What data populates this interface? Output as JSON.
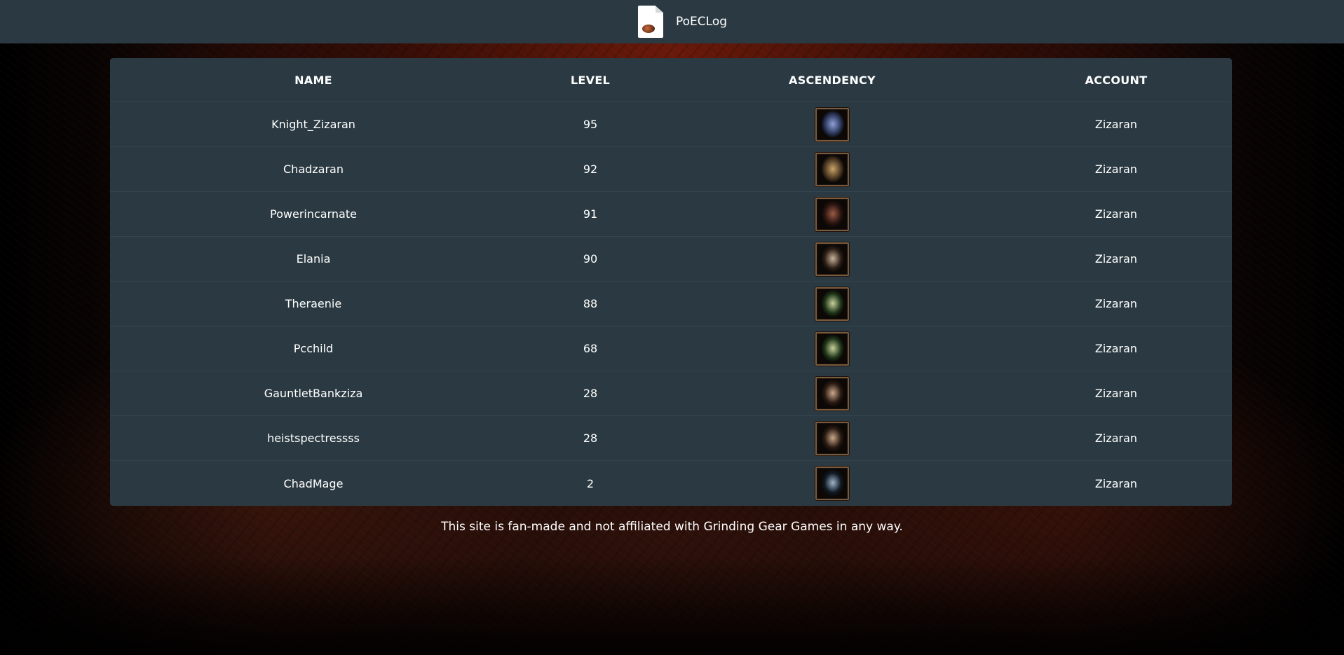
{
  "header": {
    "logo_icon": "page-with-orb-icon",
    "title": "PoECLog"
  },
  "table": {
    "columns": [
      "NAME",
      "LEVEL",
      "ASCENDENCY",
      "ACCOUNT"
    ],
    "rows": [
      {
        "name": "Knight_Zizaran",
        "level": "95",
        "ascendency_icon": "ascendancy-portrait-icon",
        "portrait_colors": [
          "#8fa0d8",
          "#2a3558"
        ],
        "account": "Zizaran"
      },
      {
        "name": "Chadzaran",
        "level": "92",
        "ascendency_icon": "ascendancy-portrait-icon",
        "portrait_colors": [
          "#c9a46a",
          "#4a3620"
        ],
        "account": "Zizaran"
      },
      {
        "name": "Powerincarnate",
        "level": "91",
        "ascendency_icon": "ascendancy-portrait-icon",
        "portrait_colors": [
          "#9a5a44",
          "#2a1410"
        ],
        "account": "Zizaran"
      },
      {
        "name": "Elania",
        "level": "90",
        "ascendency_icon": "ascendancy-portrait-icon",
        "portrait_colors": [
          "#c9b39a",
          "#2c1e16"
        ],
        "account": "Zizaran"
      },
      {
        "name": "Theraenie",
        "level": "88",
        "ascendency_icon": "ascendancy-portrait-icon",
        "portrait_colors": [
          "#c6d09a",
          "#1e3418"
        ],
        "account": "Zizaran"
      },
      {
        "name": "Pcchild",
        "level": "68",
        "ascendency_icon": "ascendancy-portrait-icon",
        "portrait_colors": [
          "#c6d09a",
          "#1e3418"
        ],
        "account": "Zizaran"
      },
      {
        "name": "GauntletBankziza",
        "level": "28",
        "ascendency_icon": "ascendancy-portrait-icon",
        "portrait_colors": [
          "#c9a88a",
          "#2a1a12"
        ],
        "account": "Zizaran"
      },
      {
        "name": "heistspectressss",
        "level": "28",
        "ascendency_icon": "ascendancy-portrait-icon",
        "portrait_colors": [
          "#c9a88a",
          "#2a1a12"
        ],
        "account": "Zizaran"
      },
      {
        "name": "ChadMage",
        "level": "2",
        "ascendency_icon": "ascendancy-portrait-icon",
        "portrait_colors": [
          "#9fb4c8",
          "#101a26"
        ],
        "account": "Zizaran"
      }
    ]
  },
  "footer": {
    "disclaimer": "This site is fan-made and not affiliated with Grinding Gear Games in any way."
  },
  "colors": {
    "bar_background": "#2b3a42",
    "row_divider": "#34454e",
    "portrait_border": "#7a5a3e"
  }
}
